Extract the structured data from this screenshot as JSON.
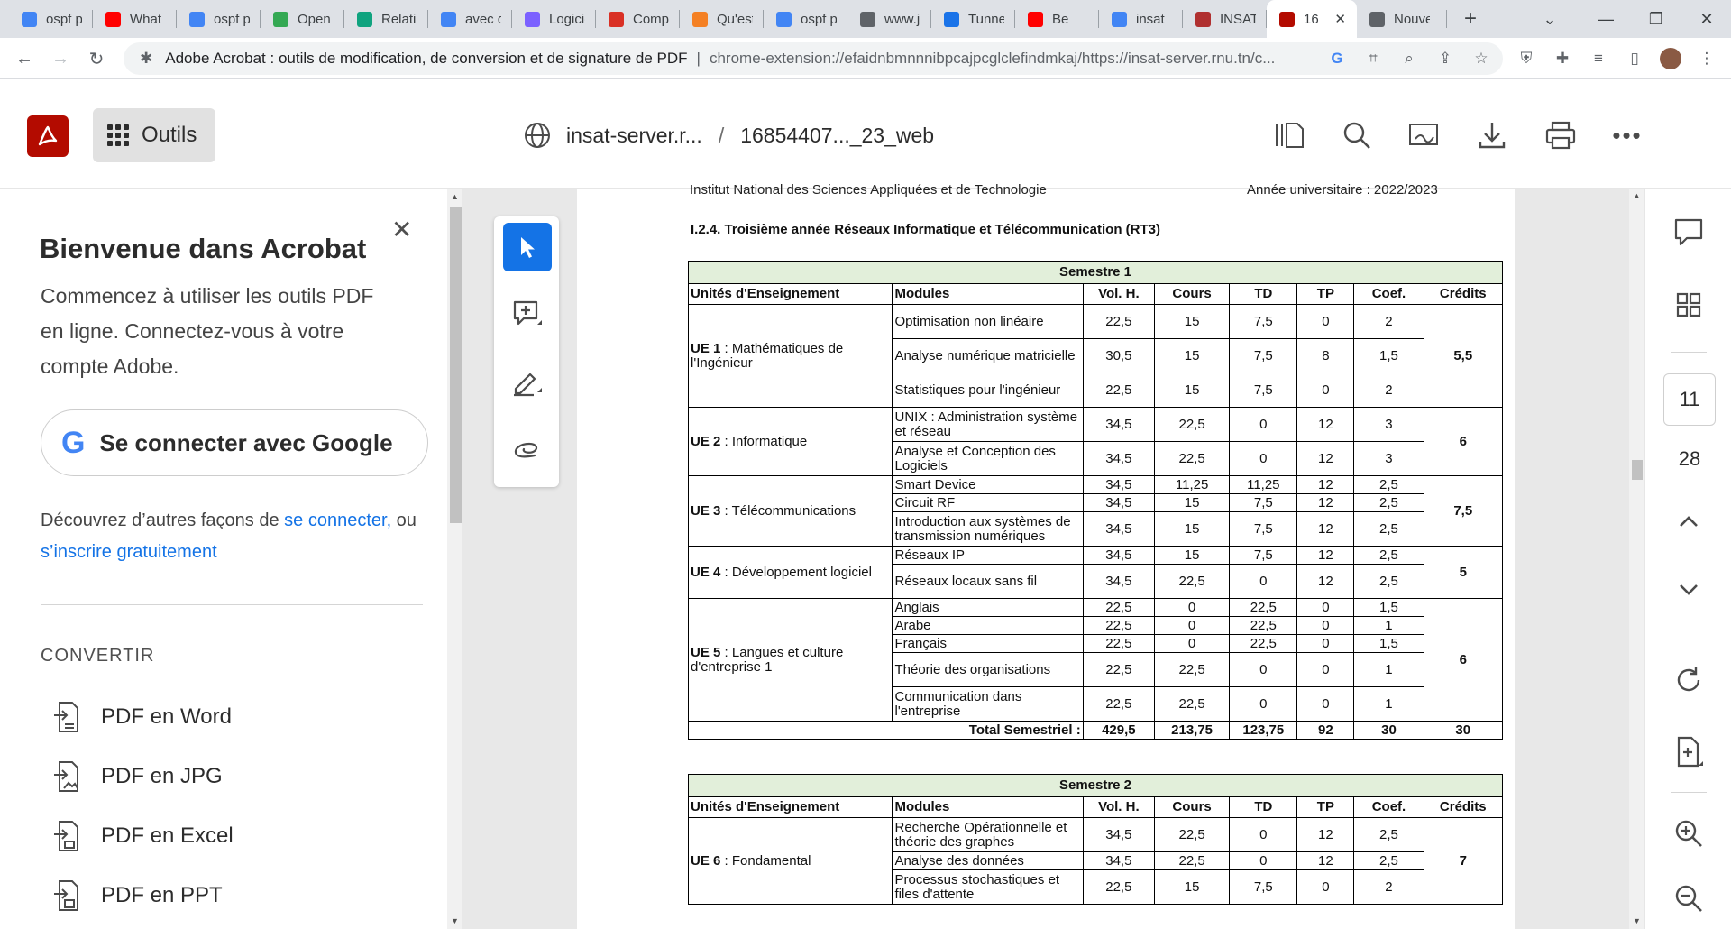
{
  "browser": {
    "tabs": [
      {
        "label": "ospf p",
        "icon": "google-icon",
        "color": "#4285f4"
      },
      {
        "label": "What i",
        "icon": "youtube-icon",
        "color": "#ff0000"
      },
      {
        "label": "ospf p",
        "icon": "google-icon",
        "color": "#4285f4"
      },
      {
        "label": "Open",
        "icon": "link-icon",
        "color": "#34a853"
      },
      {
        "label": "Relatic",
        "icon": "chatgpt-icon",
        "color": "#10a37f"
      },
      {
        "label": "avec q",
        "icon": "google-icon",
        "color": "#4285f4"
      },
      {
        "label": "Logicie",
        "icon": "site-icon",
        "color": "#7b61ff"
      },
      {
        "label": "Comp",
        "icon": "target-icon",
        "color": "#d93025"
      },
      {
        "label": "Qu'est",
        "icon": "stack-icon",
        "color": "#f48024"
      },
      {
        "label": "ospf p",
        "icon": "google-icon",
        "color": "#4285f4"
      },
      {
        "label": "www.j",
        "icon": "globe-icon",
        "color": "#5f6368"
      },
      {
        "label": "Tunne",
        "icon": "notebook-icon",
        "color": "#1a73e8"
      },
      {
        "label": "Be",
        "icon": "youtube-icon",
        "color": "#ff0000"
      },
      {
        "label": "insat",
        "icon": "google-icon",
        "color": "#4285f4"
      },
      {
        "label": "INSAT",
        "icon": "school-icon",
        "color": "#b03030"
      },
      {
        "label": "16",
        "icon": "acrobat-icon",
        "color": "#b30b00"
      },
      {
        "label": "Nouve",
        "icon": "chrome-icon",
        "color": "#5f6368"
      }
    ],
    "omnibox": {
      "title": "Adobe Acrobat : outils de modification, de conversion et de signature de PDF",
      "separator": "|",
      "url": "chrome-extension://efaidnbmnnnibpcajpcglclefindmkaj/https://insat-server.rnu.tn/c..."
    }
  },
  "acrobat": {
    "tools_label": "Outils",
    "breadcrumb": {
      "site": "insat-server.r...",
      "sep": "/",
      "file": "16854407..._23_web"
    }
  },
  "welcome": {
    "title": "Bienvenue dans Acrobat",
    "description": "Commencez à utiliser les outils PDF en ligne. Connectez-vous à votre compte Adobe.",
    "google_button": "Se connecter avec Google",
    "other_prefix": "Découvrez d’autres façons de ",
    "other_link1": "se connecter,",
    "other_middle": " ou ",
    "other_link2": "s’inscrire gratuitement",
    "section": "CONVERTIR",
    "convert_items": [
      "PDF en Word",
      "PDF en JPG",
      "PDF en Excel",
      "PDF en PPT"
    ]
  },
  "document": {
    "cut_header_left": "Institut National des Sciences Appliquées et de Technologie",
    "cut_header_right": "Année universitaire : 2022/2023",
    "section_title": "I.2.4. Troisième année Réseaux Informatique et Télécommunication (RT3)",
    "headers": [
      "Unités d'Enseignement",
      "Modules",
      "Vol. H.",
      "Cours",
      "TD",
      "TP",
      "Coef.",
      "Crédits"
    ],
    "semester1": {
      "title": "Semestre 1",
      "ues": [
        {
          "ue": "UE 1",
          "name": " : Mathématiques de l'Ingénieur",
          "credits": "5,5",
          "modules": [
            [
              "Optimisation non linéaire",
              "22,5",
              "15",
              "7,5",
              "0",
              "2"
            ],
            [
              "Analyse numérique matricielle",
              "30,5",
              "15",
              "7,5",
              "8",
              "1,5"
            ],
            [
              "Statistiques pour l'ingénieur",
              "22,5",
              "15",
              "7,5",
              "0",
              "2"
            ]
          ]
        },
        {
          "ue": "UE 2",
          "name": " :  Informatique",
          "credits": "6",
          "modules": [
            [
              "UNIX : Administration système et réseau",
              "34,5",
              "22,5",
              "0",
              "12",
              "3"
            ],
            [
              "Analyse et Conception des Logiciels",
              "34,5",
              "22,5",
              "0",
              "12",
              "3"
            ]
          ]
        },
        {
          "ue": "UE 3",
          "name": " : Télécommunications",
          "credits": "7,5",
          "modules": [
            [
              "Smart Device",
              "34,5",
              "11,25",
              "11,25",
              "12",
              "2,5"
            ],
            [
              "Circuit RF",
              "34,5",
              "15",
              "7,5",
              "12",
              "2,5"
            ],
            [
              "Introduction aux systèmes de transmission numériques",
              "34,5",
              "15",
              "7,5",
              "12",
              "2,5"
            ]
          ]
        },
        {
          "ue": "UE 4",
          "name": " : Développement logiciel",
          "credits": "5",
          "modules": [
            [
              "Réseaux IP",
              "34,5",
              "15",
              "7,5",
              "12",
              "2,5"
            ],
            [
              "Réseaux locaux sans fil",
              "34,5",
              "22,5",
              "0",
              "12",
              "2,5"
            ]
          ]
        },
        {
          "ue": "UE 5",
          "name": " : Langues et culture d'entreprise 1",
          "credits": "6",
          "modules": [
            [
              "Anglais",
              "22,5",
              "0",
              "22,5",
              "0",
              "1,5"
            ],
            [
              "Arabe",
              "22,5",
              "0",
              "22,5",
              "0",
              "1"
            ],
            [
              "Français",
              "22,5",
              "0",
              "22,5",
              "0",
              "1,5"
            ],
            [
              "Théorie des organisations",
              "22,5",
              "22,5",
              "0",
              "0",
              "1"
            ],
            [
              "Communication dans l'entreprise",
              "22,5",
              "22,5",
              "0",
              "0",
              "1"
            ]
          ]
        }
      ],
      "total_label": "Total Semestriel :",
      "total": [
        "429,5",
        "213,75",
        "123,75",
        "92",
        "30",
        "30"
      ]
    },
    "semester2": {
      "title": "Semestre 2",
      "ues": [
        {
          "ue": "UE 6",
          "name": " : Fondamental",
          "credits": "7",
          "modules": [
            [
              "Recherche Opérationnelle et théorie des graphes",
              "34,5",
              "22,5",
              "0",
              "12",
              "2,5"
            ],
            [
              "Analyse des données",
              "34,5",
              "22,5",
              "0",
              "12",
              "2,5"
            ],
            [
              "Processus stochastiques et files d'attente",
              "22,5",
              "15",
              "7,5",
              "0",
              "2"
            ]
          ]
        }
      ]
    }
  },
  "pager": {
    "current": "11",
    "total": "28"
  }
}
